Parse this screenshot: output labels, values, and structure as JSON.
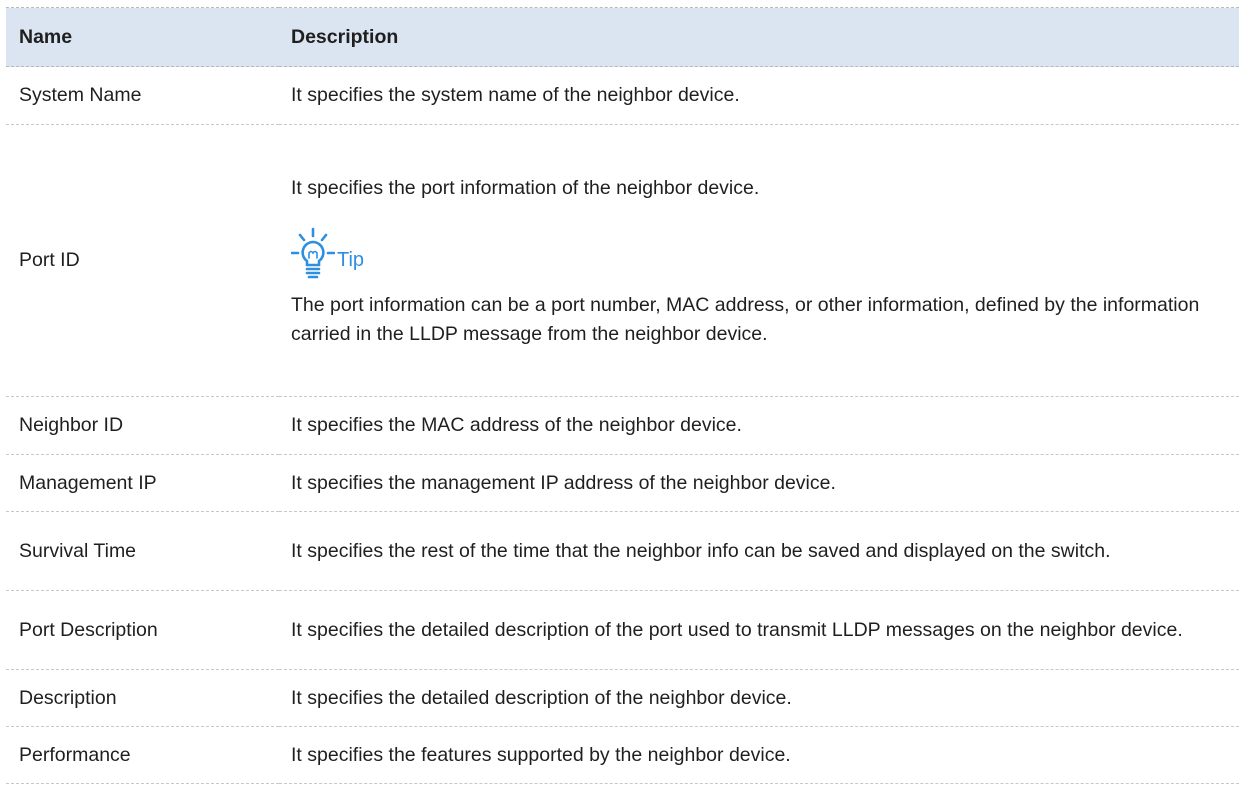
{
  "table": {
    "header": {
      "name": "Name",
      "description": "Description"
    },
    "rows": [
      {
        "name": "System Name",
        "description": "It specifies the system name of the neighbor device."
      },
      {
        "name": "Port ID",
        "description": "It specifies the port information of the neighbor device.",
        "tip": {
          "icon": "lightbulb-icon",
          "label": "Tip",
          "text": "The port information can be a port number, MAC address, or other information, defined by the information carried in the LLDP message from the neighbor device."
        }
      },
      {
        "name": "Neighbor ID",
        "description": "It specifies the MAC address of the neighbor device."
      },
      {
        "name": "Management IP",
        "description": "It specifies the management IP address of the neighbor device."
      },
      {
        "name": "Survival Time",
        "description": "It specifies the rest of the time that the neighbor info can be saved and displayed on the switch."
      },
      {
        "name": "Port Description",
        "description": "It specifies the detailed description of the port used to transmit LLDP messages on the neighbor device."
      },
      {
        "name": "Description",
        "description": "It specifies the detailed description of the neighbor device."
      },
      {
        "name": "Performance",
        "description": "It specifies the features supported by the neighbor device."
      }
    ]
  },
  "colors": {
    "header_bg": "#dbe4f1",
    "tip_accent": "#2c8fe0",
    "text": "#1f1f1f"
  }
}
